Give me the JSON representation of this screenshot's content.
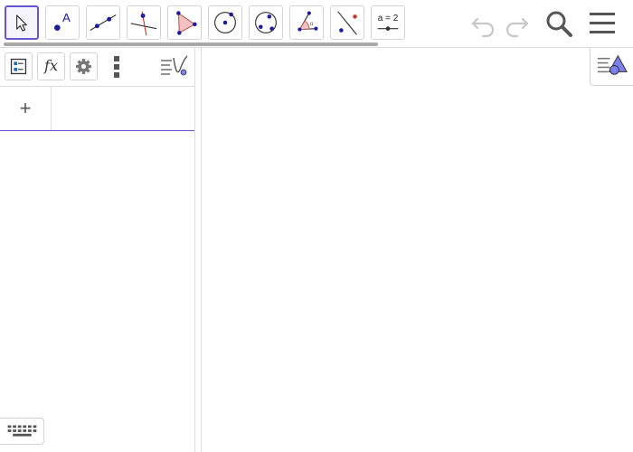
{
  "toolbar": {
    "tools": [
      {
        "name": "move"
      },
      {
        "name": "point"
      },
      {
        "name": "line"
      },
      {
        "name": "perpendicular-line"
      },
      {
        "name": "polygon"
      },
      {
        "name": "circle-center-point"
      },
      {
        "name": "circle-three-points"
      },
      {
        "name": "angle"
      },
      {
        "name": "reflect-about-line"
      },
      {
        "name": "slider",
        "label": "a = 2"
      }
    ],
    "active_tool": "move",
    "point_label": "A",
    "actions": [
      "undo-icon",
      "redo-icon",
      "search-icon",
      "menu-icon"
    ]
  },
  "algebra": {
    "header_buttons": [
      "algebra-view-icon",
      "fx-icon",
      "gear-icon",
      "more-vert-icon",
      "algebra-view-toggle-icon"
    ],
    "fx_label": "fx",
    "add_label": "+",
    "input_value": ""
  },
  "graphics": {
    "style_bar_icon": "graphics-style-icon"
  },
  "keyboard": {
    "icon": "keyboard-icon"
  },
  "colors": {
    "accent": "#6557d2",
    "point": "#1c1c9a",
    "polygon_fill": "#f2c1c1",
    "polygon_edge": "#c25b5b",
    "icon_gray": "#5a5a5a",
    "disabled_gray": "#c8c8c8"
  }
}
